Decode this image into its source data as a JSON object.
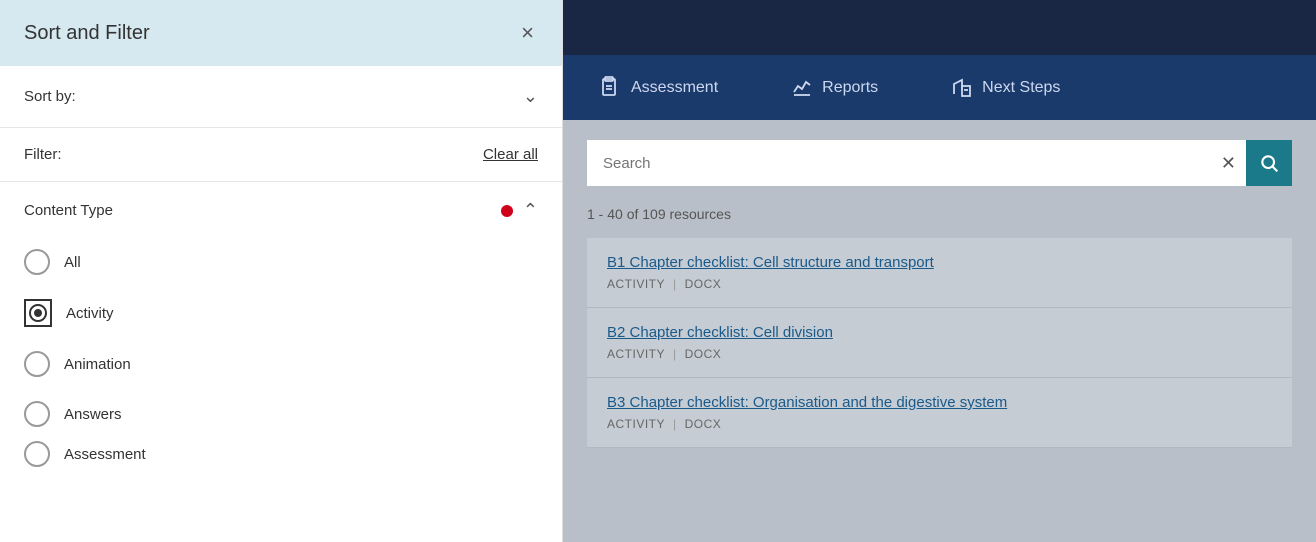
{
  "leftPanel": {
    "title": "Sort and Filter",
    "closeBtn": "×",
    "sortSection": {
      "label": "Sort by:",
      "chevron": "chevron-down"
    },
    "filterSection": {
      "label": "Filter:",
      "clearAll": "Clear all"
    },
    "contentType": {
      "label": "Content Type",
      "options": [
        {
          "id": "all",
          "label": "All",
          "selected": false
        },
        {
          "id": "activity",
          "label": "Activity",
          "selected": true
        },
        {
          "id": "animation",
          "label": "Animation",
          "selected": false
        },
        {
          "id": "answers",
          "label": "Answers",
          "selected": false
        },
        {
          "id": "assessment",
          "label": "Assessment",
          "selected": false
        }
      ]
    }
  },
  "rightPanel": {
    "nav": {
      "items": [
        {
          "id": "assessment",
          "label": "Assessment"
        },
        {
          "id": "reports",
          "label": "Reports"
        },
        {
          "id": "next-steps",
          "label": "Next Steps"
        }
      ]
    },
    "search": {
      "placeholder": "Search",
      "value": ""
    },
    "resultsCount": "1 - 40 of 109 resources",
    "resources": [
      {
        "title": "B1 Chapter checklist: Cell structure and transport",
        "type": "ACTIVITY",
        "format": "DOCX"
      },
      {
        "title": "B2 Chapter checklist: Cell division",
        "type": "ACTIVITY",
        "format": "DOCX"
      },
      {
        "title": "B3 Chapter checklist: Organisation and the digestive system",
        "type": "ACTIVITY",
        "format": "DOCX"
      }
    ]
  }
}
